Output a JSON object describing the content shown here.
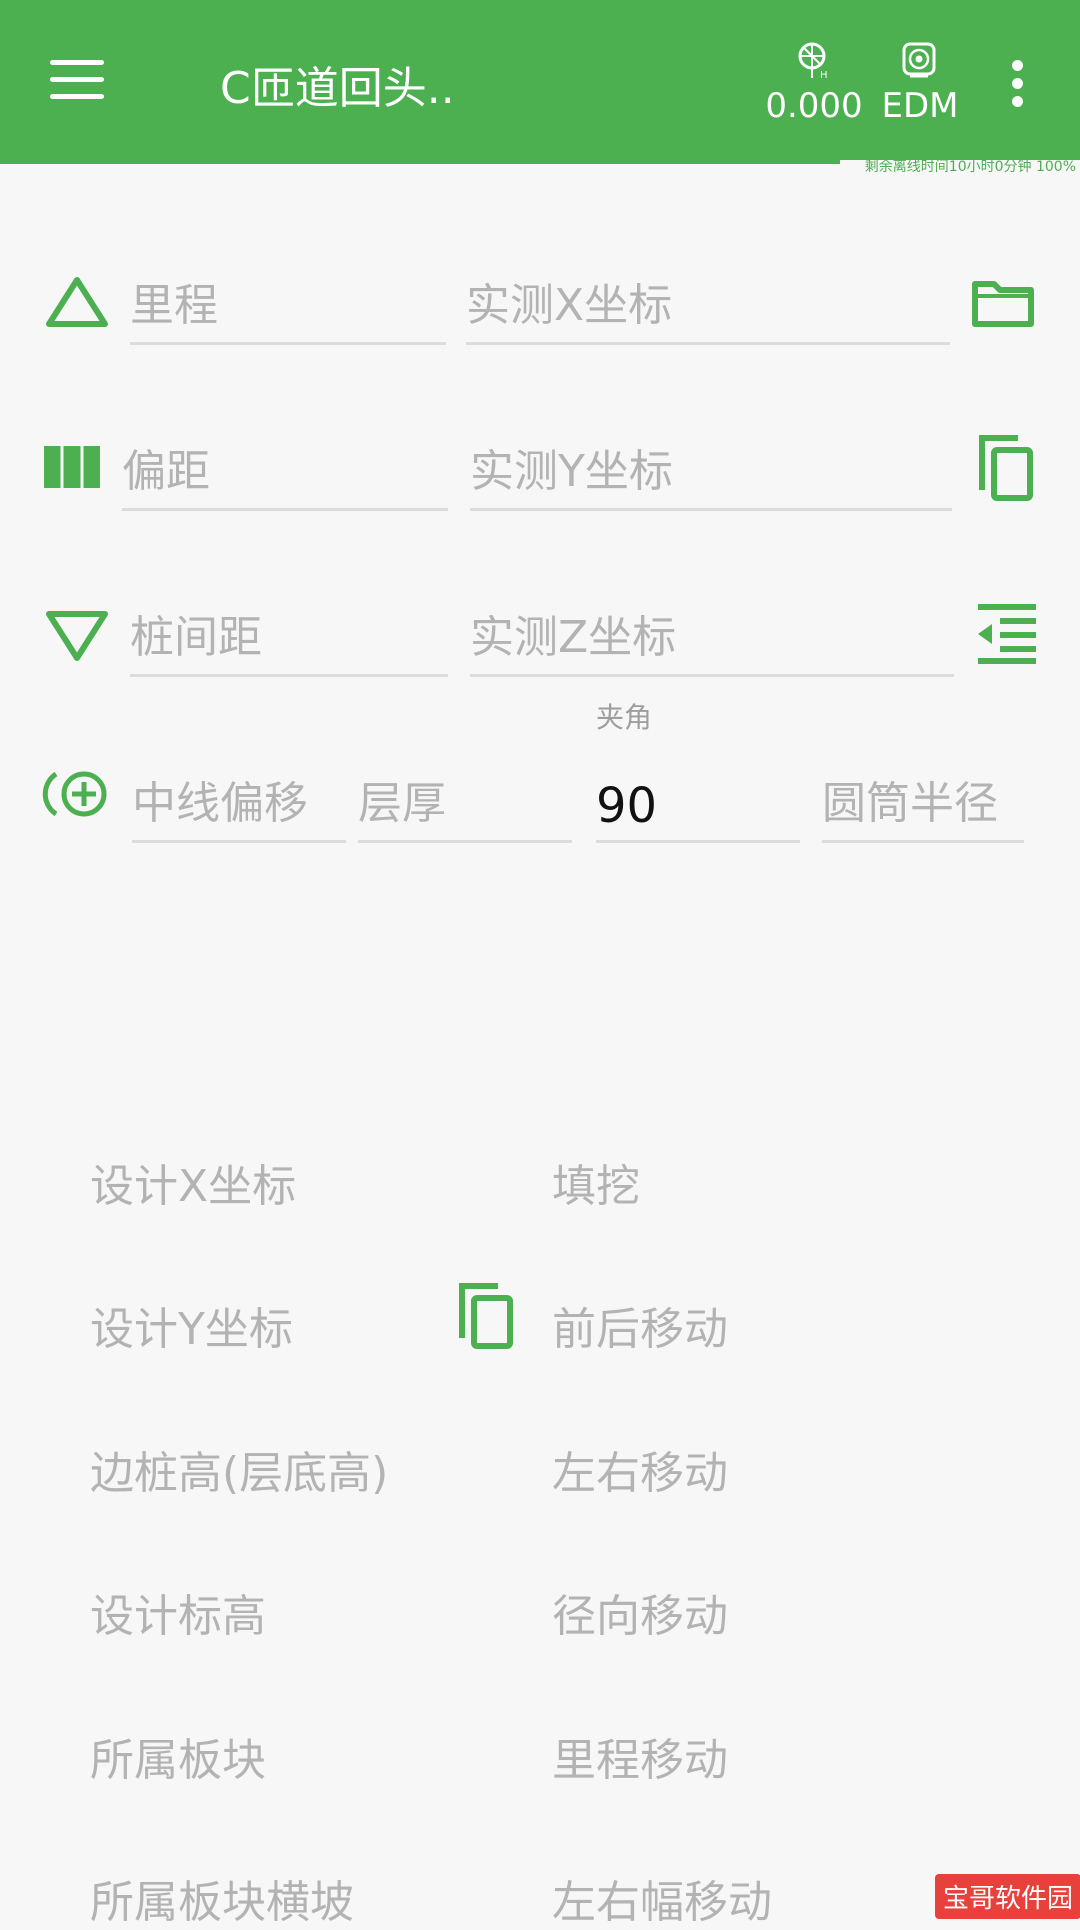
{
  "appbar": {
    "title": "C匝道回头..",
    "tilt_value": "0.000",
    "edm_label": "EDM"
  },
  "offline_status": "剩余离线时间10小时0分钟 100%",
  "inputs": {
    "mileage": {
      "placeholder": "里程"
    },
    "measured_x": {
      "placeholder": "实测X坐标"
    },
    "offset": {
      "placeholder": "偏距"
    },
    "measured_y": {
      "placeholder": "实测Y坐标"
    },
    "pile_spacing": {
      "placeholder": "桩间距"
    },
    "measured_z": {
      "placeholder": "实测Z坐标"
    },
    "centerline_offset": {
      "placeholder": "中线偏移"
    },
    "layer_thickness": {
      "placeholder": "层厚"
    },
    "angle": {
      "label": "夹角",
      "value": "90"
    },
    "cylinder_radius": {
      "placeholder": "圆筒半径"
    }
  },
  "results": {
    "left": [
      "设计X坐标",
      "设计Y坐标",
      "边桩高(层底高)",
      "设计标高",
      "所属板块",
      "所属板块横坡"
    ],
    "right": [
      "填挖",
      "前后移动",
      "左右移动",
      "径向移动",
      "里程移动",
      "左右幅移动"
    ]
  },
  "watermark": "宝哥软件园",
  "colors": {
    "accent": "#4caf50",
    "placeholder": "#b3b3b3",
    "underline": "#dcdcdc"
  },
  "icons": [
    "menu-icon",
    "tilt-sensor-icon",
    "edm-icon",
    "more-vert-icon",
    "triangle-up-icon",
    "columns-icon",
    "triangle-down-icon",
    "add-target-icon",
    "folder-icon",
    "copy-icon",
    "indent-list-icon"
  ]
}
